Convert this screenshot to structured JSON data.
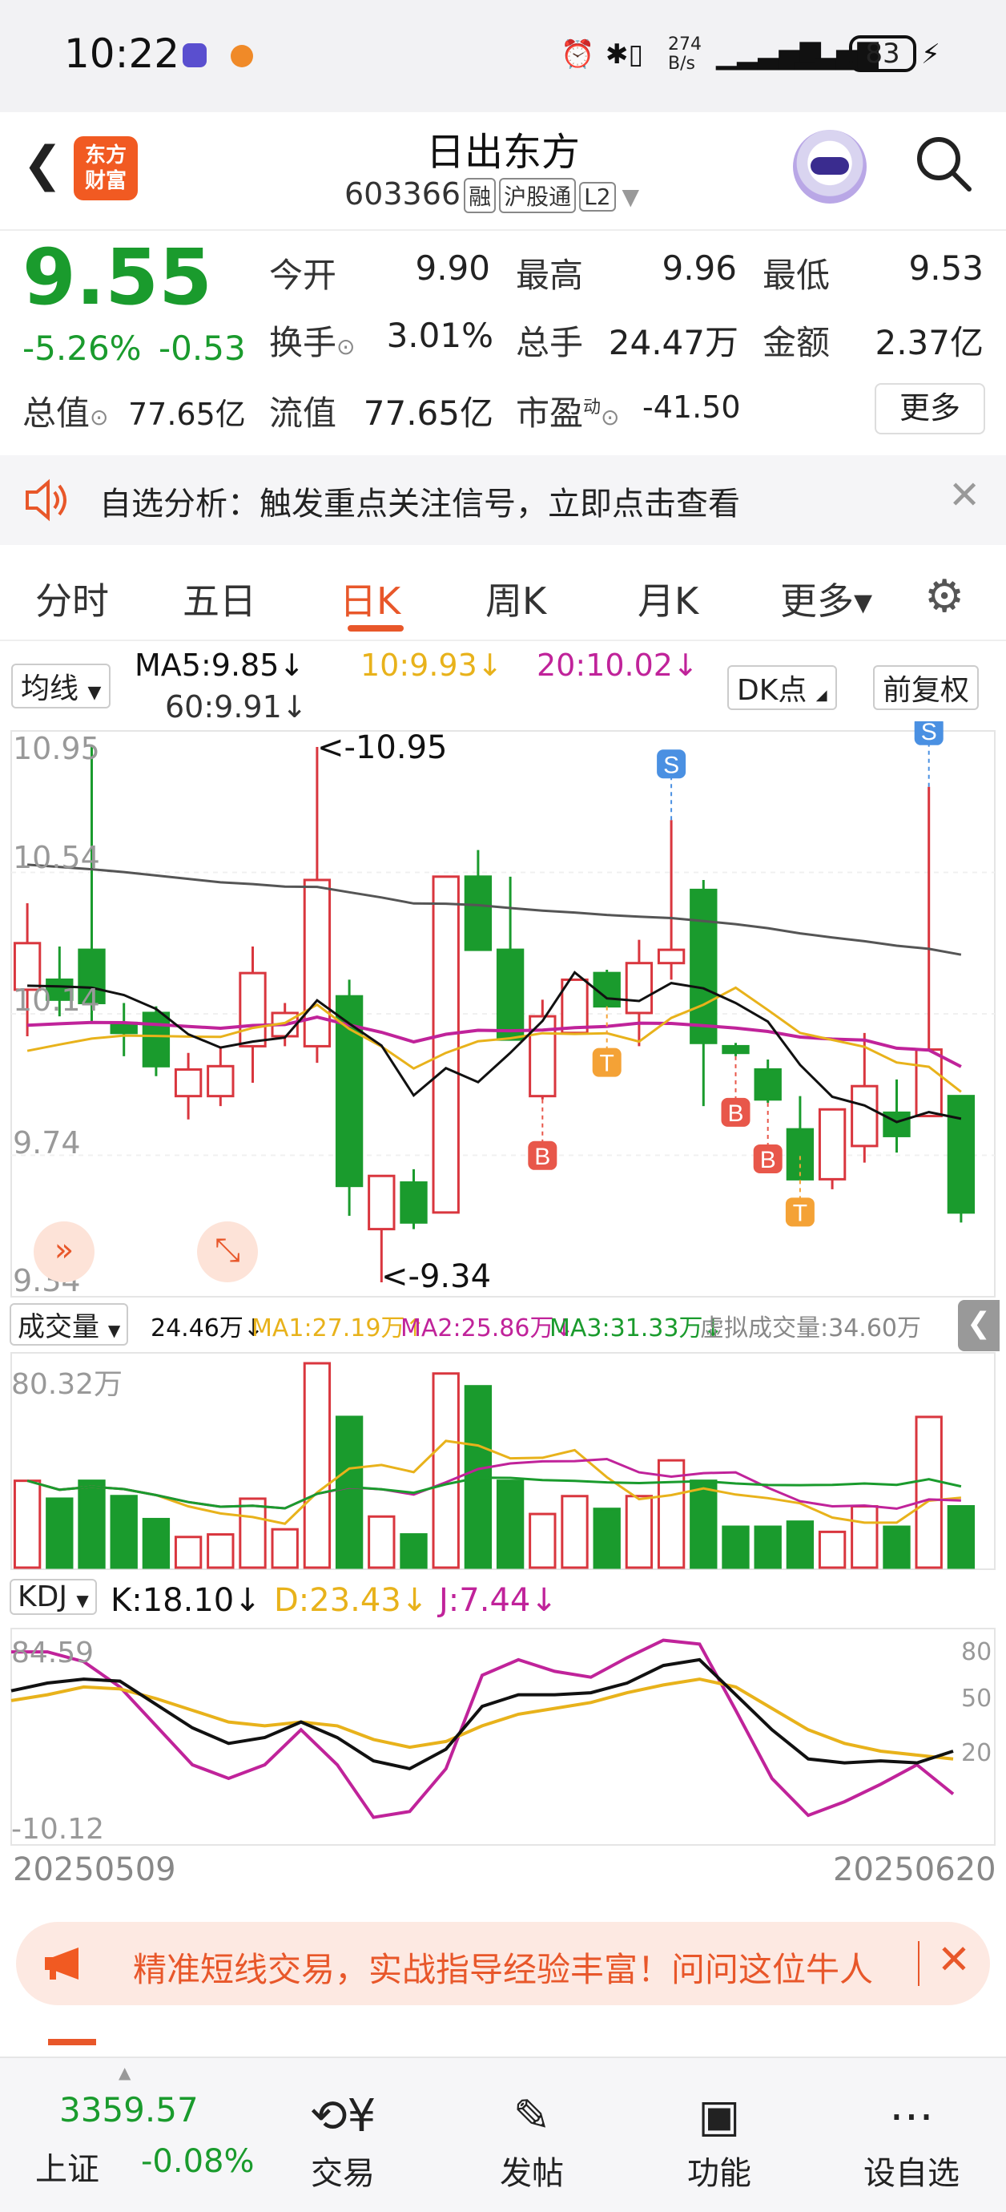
{
  "status_bar": {
    "time": "10:22",
    "net_speed": "274\nB/s",
    "battery": "83"
  },
  "header": {
    "logo_line1": "东方",
    "logo_line2": "财富",
    "title": "日出东方",
    "code": "603366",
    "tags": [
      "融",
      "沪股通",
      "L2"
    ]
  },
  "quote": {
    "price": "9.55",
    "change_pct": "-5.26%",
    "change": "-0.53",
    "open_label": "今开",
    "open": "9.90",
    "high_label": "最高",
    "high": "9.96",
    "low_label": "最低",
    "low": "9.53",
    "turnover_label": "换手",
    "turnover": "3.01%",
    "volume_label": "总手",
    "volume": "24.47万",
    "amount_label": "金额",
    "amount": "2.37亿",
    "mktcap_label": "总值",
    "mktcap": "77.65亿",
    "float_label": "流值",
    "float": "77.65亿",
    "pe_label": "市盈",
    "pe_sup": "动",
    "pe": "-41.50",
    "more_button": "更多"
  },
  "alert": {
    "text": "自选分析：触发重点关注信号，立即点击查看"
  },
  "tabs": [
    "分时",
    "五日",
    "日K",
    "周K",
    "月K",
    "更多▾"
  ],
  "ma_bar": {
    "dropdown": "均线",
    "ma5": "MA5:9.85↓",
    "ma10": "10:9.93↓",
    "ma20": "20:10.02↓",
    "ma60": "60:9.91↓",
    "dk_button": "DK点",
    "adjust_button": "前复权"
  },
  "colors": {
    "up": "#d9363e",
    "down": "#1a9b2d",
    "ma5": "#111111",
    "ma10": "#e8b21b",
    "ma20": "#c0239a",
    "ma60": "#555555",
    "accent": "#e8572a"
  },
  "chart_data": [
    {
      "type": "candlestick",
      "price_axis_labels": [
        "10.95",
        "10.54",
        "10.14",
        "9.74",
        "9.34"
      ],
      "max_label": "<-10.95",
      "min_label": "<-9.34",
      "x_start": "20250509",
      "x_end": "20250620",
      "candles": [
        {
          "o": 10.22,
          "h": 10.48,
          "l": 10.08,
          "c": 10.36
        },
        {
          "o": 10.25,
          "h": 10.35,
          "l": 10.14,
          "c": 10.19
        },
        {
          "o": 10.34,
          "h": 10.95,
          "l": 10.12,
          "c": 10.18
        },
        {
          "o": 10.12,
          "h": 10.18,
          "l": 10.02,
          "c": 10.09
        },
        {
          "o": 10.15,
          "h": 10.17,
          "l": 9.96,
          "c": 9.99
        },
        {
          "o": 9.9,
          "h": 10.03,
          "l": 9.83,
          "c": 9.98
        },
        {
          "o": 9.9,
          "h": 10.05,
          "l": 9.87,
          "c": 9.99
        },
        {
          "o": 10.05,
          "h": 10.35,
          "l": 9.94,
          "c": 10.27
        },
        {
          "o": 10.08,
          "h": 10.18,
          "l": 10.05,
          "c": 10.15
        },
        {
          "o": 10.05,
          "h": 10.95,
          "l": 10.0,
          "c": 10.55
        },
        {
          "o": 10.2,
          "h": 10.25,
          "l": 9.54,
          "c": 9.63
        },
        {
          "o": 9.5,
          "h": 9.65,
          "l": 9.34,
          "c": 9.66
        },
        {
          "o": 9.64,
          "h": 9.68,
          "l": 9.5,
          "c": 9.52
        },
        {
          "o": 9.55,
          "h": 10.56,
          "l": 9.55,
          "c": 10.56
        },
        {
          "o": 10.56,
          "h": 10.64,
          "l": 10.34,
          "c": 10.34
        },
        {
          "o": 10.34,
          "h": 10.56,
          "l": 10.07,
          "c": 10.07
        },
        {
          "o": 9.9,
          "h": 10.19,
          "l": 9.89,
          "c": 10.14
        },
        {
          "o": 10.09,
          "h": 10.25,
          "l": 10.09,
          "c": 10.25
        },
        {
          "o": 10.27,
          "h": 10.28,
          "l": 10.17,
          "c": 10.17
        },
        {
          "o": 10.15,
          "h": 10.37,
          "l": 10.05,
          "c": 10.3
        },
        {
          "o": 10.3,
          "h": 10.73,
          "l": 10.25,
          "c": 10.34
        },
        {
          "o": 10.52,
          "h": 10.55,
          "l": 9.87,
          "c": 10.06
        },
        {
          "o": 10.05,
          "h": 10.06,
          "l": 10.02,
          "c": 10.03
        },
        {
          "o": 9.98,
          "h": 10.01,
          "l": 9.88,
          "c": 9.89
        },
        {
          "o": 9.8,
          "h": 9.9,
          "l": 9.72,
          "c": 9.65
        },
        {
          "o": 9.65,
          "h": 9.85,
          "l": 9.62,
          "c": 9.86
        },
        {
          "o": 9.75,
          "h": 10.09,
          "l": 9.7,
          "c": 9.93
        },
        {
          "o": 9.85,
          "h": 9.95,
          "l": 9.73,
          "c": 9.78
        },
        {
          "o": 9.84,
          "h": 10.83,
          "l": 9.84,
          "c": 10.04
        },
        {
          "o": 9.9,
          "h": 9.9,
          "l": 9.52,
          "c": 9.55
        }
      ],
      "signals": [
        {
          "label": "S",
          "index": 20,
          "type": "sell"
        },
        {
          "label": "B",
          "index": 16,
          "type": "buy"
        },
        {
          "label": "T",
          "index": 18,
          "type": "t"
        },
        {
          "label": "B",
          "index": 22,
          "type": "buy"
        },
        {
          "label": "B",
          "index": 23,
          "type": "buy"
        },
        {
          "label": "T",
          "index": 24,
          "type": "t"
        },
        {
          "label": "S",
          "index": 28,
          "type": "sell"
        }
      ]
    },
    {
      "type": "bar",
      "name": "成交量",
      "axis_label": "80.32万",
      "legend": {
        "vol": "24.46万↓",
        "ma1": "MA1:27.19万↑",
        "ma2": "MA2:25.86万↓",
        "ma3": "MA3:31.33万↓",
        "virtual": "虚拟成交量:34.60万"
      },
      "values": [
        34,
        27,
        34,
        28,
        19,
        12,
        13,
        27,
        15,
        80,
        59,
        20,
        13,
        76,
        71,
        34,
        21,
        28,
        23,
        28,
        42,
        34,
        16,
        16,
        18,
        14,
        24,
        16,
        59,
        24
      ]
    },
    {
      "type": "line",
      "name": "KDJ",
      "legend": {
        "k": "K:18.10↓",
        "d": "D:23.43↓",
        "j": "J:7.44↓"
      },
      "axis_labels": {
        "top": "84.59",
        "bottom": "-10.12",
        "right": [
          "80",
          "50",
          "20"
        ]
      },
      "k": [
        60,
        64,
        66,
        65,
        53,
        41,
        33,
        36,
        44,
        36,
        24,
        20,
        30,
        52,
        58,
        58,
        59,
        64,
        73,
        76,
        58,
        40,
        25,
        23,
        24,
        23,
        29
      ],
      "d": [
        55,
        58,
        62,
        61,
        56,
        50,
        44,
        42,
        44,
        42,
        35,
        31,
        34,
        42,
        48,
        51,
        54,
        59,
        63,
        66,
        62,
        51,
        40,
        33,
        29,
        27,
        25
      ],
      "j": [
        80,
        80,
        75,
        62,
        42,
        22,
        15,
        22,
        40,
        22,
        -5,
        -2,
        20,
        68,
        76,
        70,
        67,
        77,
        86,
        84,
        50,
        15,
        -4,
        3,
        12,
        22,
        7
      ]
    }
  ],
  "promo": {
    "text": "精准短线交易，实战指导经验丰富！问问这位牛人"
  },
  "bottom_nav": {
    "index_name": "上证",
    "index_value": "3359.57",
    "index_change": "-0.08%",
    "items": [
      "交易",
      "发帖",
      "功能",
      "设自选"
    ]
  }
}
